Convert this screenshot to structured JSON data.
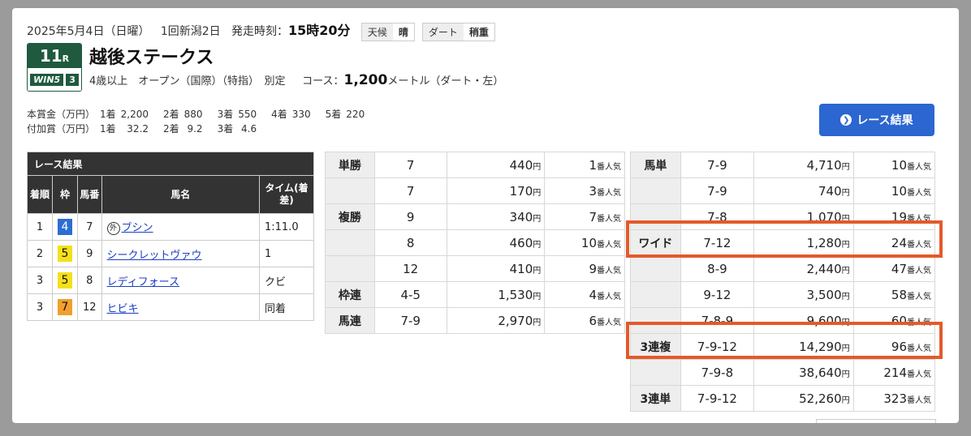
{
  "header": {
    "date": "2025年5月4日（日曜）",
    "meeting": "1回新潟2日",
    "start_label": "発走時刻：",
    "start_time": "15時20分",
    "weather_label": "天候",
    "weather": "晴",
    "track_label": "ダート",
    "track": "稍重"
  },
  "race": {
    "number": "11",
    "r": "R",
    "win5_text": "WIN5",
    "win5_num": "3",
    "name": "越後ステークス",
    "conditions": "4歳以上　オープン（国際）（特指）　別定",
    "course_label": "コース：",
    "distance": "1,200",
    "unit": "メートル（ダート・左）"
  },
  "prize": {
    "row1_label": "本賞金（万円）",
    "row1": [
      [
        "1着",
        "2,200"
      ],
      [
        "2着",
        "880"
      ],
      [
        "3着",
        "550"
      ],
      [
        "4着",
        "330"
      ],
      [
        "5着",
        "220"
      ]
    ],
    "row2_label": "付加賞（万円）",
    "row2": [
      [
        "1着",
        "32.2"
      ],
      [
        "2着",
        "9.2"
      ],
      [
        "3着",
        "4.6"
      ]
    ]
  },
  "button": {
    "label": "レース結果"
  },
  "results": {
    "title": "レース結果",
    "headers": [
      "着順",
      "枠",
      "馬番",
      "馬名",
      "タイム(着差)"
    ],
    "rows": [
      {
        "rank": "1",
        "frame": "4",
        "num": "7",
        "name": "ブシン",
        "mark": "外",
        "time": "1:11.0",
        "frame_color": "#2c6dd2",
        "frame_text": "#fff"
      },
      {
        "rank": "2",
        "frame": "5",
        "num": "9",
        "name": "シークレットヴァウ",
        "mark": "",
        "time": "1",
        "frame_color": "#f4e01c",
        "frame_text": "#111"
      },
      {
        "rank": "3",
        "frame": "5",
        "num": "8",
        "name": "レディフォース",
        "mark": "",
        "time": "クビ",
        "frame_color": "#f4e01c",
        "frame_text": "#111"
      },
      {
        "rank": "3",
        "frame": "7",
        "num": "12",
        "name": "ヒビキ",
        "mark": "",
        "time": "同着",
        "frame_color": "#f0a030",
        "frame_text": "#111"
      }
    ]
  },
  "payouts_left": {
    "yen": "円",
    "pop": "番人気",
    "rows": [
      {
        "type": "単勝",
        "combo": "7",
        "amount": "440",
        "pop": "1"
      },
      {
        "type": "",
        "combo": "7",
        "amount": "170",
        "pop": "3"
      },
      {
        "type": "複勝",
        "combo": "9",
        "amount": "340",
        "pop": "7"
      },
      {
        "type": "",
        "combo": "8",
        "amount": "460",
        "pop": "10"
      },
      {
        "type": "",
        "combo": "12",
        "amount": "410",
        "pop": "9"
      },
      {
        "type": "枠連",
        "combo": "4-5",
        "amount": "1,530",
        "pop": "4"
      },
      {
        "type": "馬連",
        "combo": "7-9",
        "amount": "2,970",
        "pop": "6"
      }
    ]
  },
  "payouts_right": {
    "rows": [
      {
        "type": "馬単",
        "combo": "7-9",
        "amount": "4,710",
        "pop": "10"
      },
      {
        "type": "",
        "combo": "7-9",
        "amount": "740",
        "pop": "10"
      },
      {
        "type": "",
        "combo": "7-8",
        "amount": "1,070",
        "pop": "19"
      },
      {
        "type": "ワイド",
        "combo": "7-12",
        "amount": "1,280",
        "pop": "24"
      },
      {
        "type": "",
        "combo": "8-9",
        "amount": "2,440",
        "pop": "47"
      },
      {
        "type": "",
        "combo": "9-12",
        "amount": "3,500",
        "pop": "58"
      },
      {
        "type": "",
        "combo": "7-8-9",
        "amount": "9,600",
        "pop": "60"
      },
      {
        "type": "3連複",
        "combo": "7-9-12",
        "amount": "14,290",
        "pop": "96"
      },
      {
        "type": "",
        "combo": "7-9-8",
        "amount": "38,640",
        "pop": "214"
      },
      {
        "type": "3連単",
        "combo": "7-9-12",
        "amount": "52,260",
        "pop": "323"
      }
    ]
  },
  "colors": {
    "highlight": "#e35a2a",
    "button": "#2b66d1",
    "race_box": "#1f5a3e"
  }
}
